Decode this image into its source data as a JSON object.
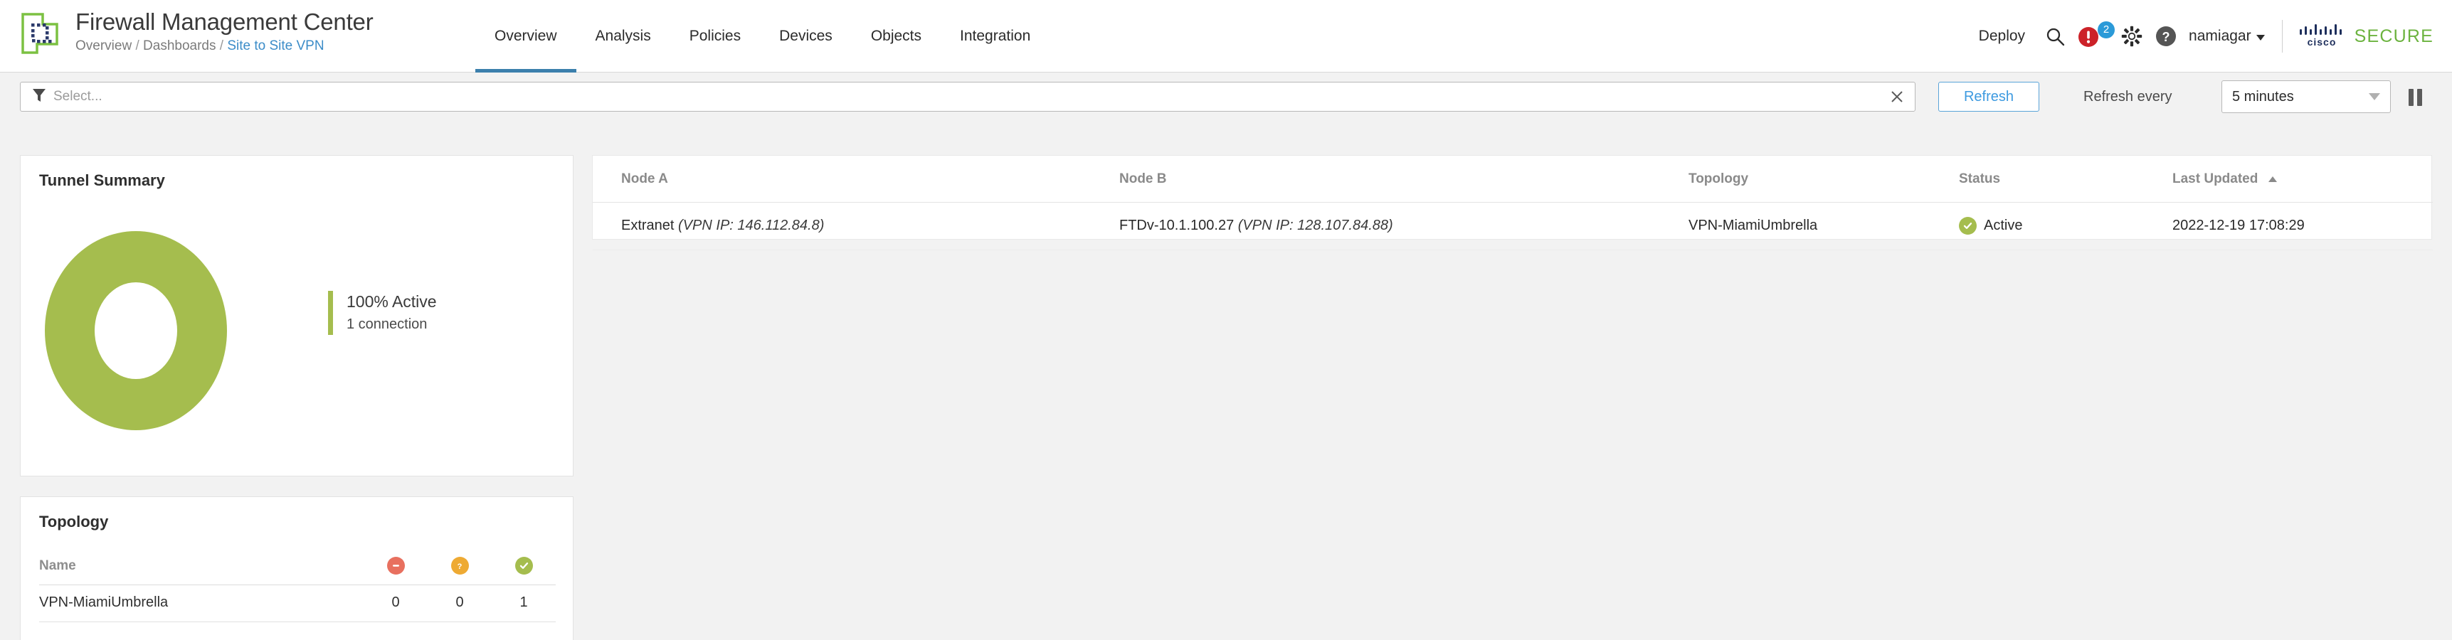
{
  "header": {
    "app_title": "Firewall Management Center",
    "breadcrumb": {
      "root": "Overview",
      "sep1": "/",
      "mid": "Dashboards",
      "sep2": "/",
      "current": "Site to Site VPN"
    },
    "tabs": [
      {
        "label": "Overview",
        "active": true
      },
      {
        "label": "Analysis",
        "active": false
      },
      {
        "label": "Policies",
        "active": false
      },
      {
        "label": "Devices",
        "active": false
      },
      {
        "label": "Objects",
        "active": false
      },
      {
        "label": "Integration",
        "active": false
      }
    ],
    "deploy_label": "Deploy",
    "search_icon": "search-icon",
    "alert_icon": "alert-exclamation-icon",
    "alert_badge_count": "2",
    "settings_icon": "gear-icon",
    "help_icon": "question-circle-icon",
    "user_name": "namiagar",
    "brand_logo_icon": "firewall-chip-logo",
    "cisco_wordmark": "cisco",
    "secure_word": "SECURE",
    "accent_blue": "#3b7fac",
    "link_blue": "#3b8cc8",
    "secure_green": "#6cb33f"
  },
  "toolbar": {
    "filter_icon": "funnel-icon",
    "filter_value": "",
    "filter_placeholder": "Select...",
    "clear_icon": "close-x-icon",
    "refresh_label": "Refresh",
    "refresh_every_label": "Refresh every",
    "refresh_interval_selected": "5 minutes",
    "refresh_interval_options": [
      "5 minutes"
    ],
    "pause_icon": "pause-icon"
  },
  "tunnel_summary": {
    "title": "Tunnel Summary",
    "legend_primary": "100% Active",
    "legend_secondary": "1 connection"
  },
  "topology_panel": {
    "title": "Topology",
    "columns": [
      {
        "label": "Name",
        "icon": null
      },
      {
        "label": "",
        "icon": "status-down-icon",
        "color": "#e8705f"
      },
      {
        "label": "",
        "icon": "status-unknown-icon",
        "color": "#eeaa33"
      },
      {
        "label": "",
        "icon": "status-active-icon",
        "color": "#a5bd4e"
      }
    ],
    "rows": [
      {
        "name": "VPN-MiamiUmbrella",
        "down": "0",
        "unknown": "0",
        "active": "1"
      }
    ]
  },
  "main_table": {
    "columns": [
      {
        "label": "Node A",
        "sorted": false
      },
      {
        "label": "Node B",
        "sorted": false
      },
      {
        "label": "Topology",
        "sorted": false
      },
      {
        "label": "Status",
        "sorted": false
      },
      {
        "label": "Last Updated",
        "sorted": true,
        "sort_dir": "asc"
      }
    ],
    "rows": [
      {
        "node_a_name": "Extranet",
        "node_a_ip": "(VPN IP: 146.112.84.8)",
        "node_b_name": "FTDv-10.1.100.27",
        "node_b_ip": "(VPN IP: 128.107.84.88)",
        "topology": "VPN-MiamiUmbrella",
        "status": "Active",
        "status_icon": "status-active-icon",
        "last_updated": "2022-12-19 17:08:29"
      }
    ]
  },
  "chart_data": {
    "type": "pie",
    "title": "Tunnel Summary",
    "labels": [
      "Active"
    ],
    "values": [
      100
    ],
    "counts": [
      1
    ],
    "colors": [
      "#a5bd4e"
    ],
    "unit": "%",
    "donut": true,
    "legend_position": "right",
    "annotations": [
      "100% Active",
      "1 connection"
    ]
  }
}
